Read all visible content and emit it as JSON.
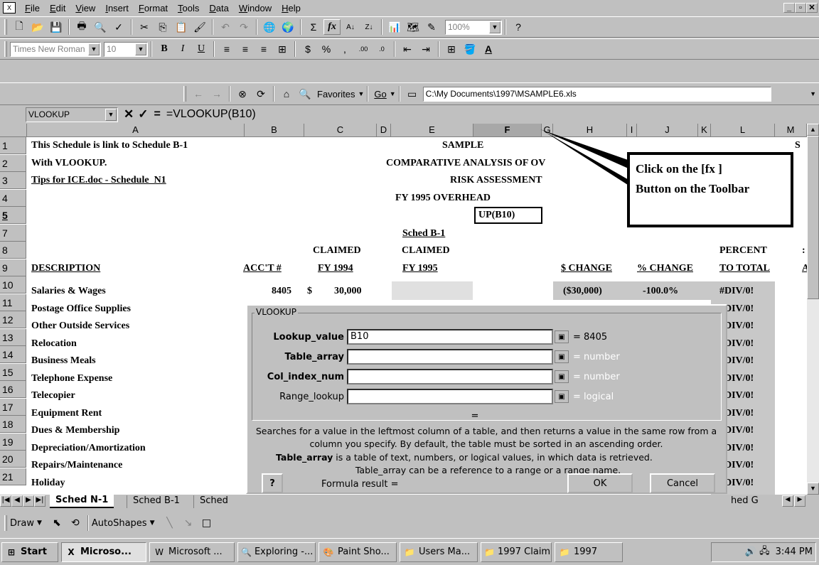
{
  "menu": {
    "items": [
      "File",
      "Edit",
      "View",
      "Insert",
      "Format",
      "Tools",
      "Data",
      "Window",
      "Help"
    ],
    "window_controls": [
      "_",
      "▫",
      "✕"
    ]
  },
  "toolbar": {
    "zoom": "100%",
    "font_name": "Times New Roman",
    "font_size": "10"
  },
  "web_toolbar": {
    "favorites": "Favorites",
    "go": "Go",
    "address": "C:\\My Documents\\1997\\MSAMPLE6.xls"
  },
  "formula_bar": {
    "name_box": "VLOOKUP",
    "cancel": "✕",
    "enter": "✓",
    "equals": "=",
    "formula": "=VLOOKUP(B10)"
  },
  "grid": {
    "columns": [
      "A",
      "B",
      "C",
      "D",
      "E",
      "F",
      "G",
      "H",
      "I",
      "J",
      "K",
      "L",
      "M"
    ],
    "row_numbers": [
      "1",
      "2",
      "3",
      "4",
      "5",
      "7",
      "8",
      "9",
      "10",
      "11",
      "12",
      "13",
      "14",
      "15",
      "16",
      "17",
      "18",
      "19",
      "20",
      "21"
    ],
    "row1_a": "This Schedule is link to Schedule B-1",
    "row1_title": "SAMPLE",
    "row1_right": "S",
    "row2_a": "With VLOOKUP.",
    "row2_title": "COMPARATIVE ANALYSIS OF OV",
    "row3_a": "Tips for ICE.doc - Schedule_N1",
    "row3_title": "RISK ASSESSMENT",
    "row4_title": "FY 1995 OVERHEAD",
    "row5_formula": "UP(B10)",
    "row7_e": "Sched B-1",
    "row8_c": "CLAIMED",
    "row8_e": "CLAIMED",
    "row8_l": "PERCENT",
    "row8_m": ":",
    "row9_a": "DESCRIPTION",
    "row9_b": "ACC'T #",
    "row9_c": "FY 1994",
    "row9_e": "FY 1995",
    "row9_h": "$ CHANGE",
    "row9_j": "% CHANGE",
    "row9_l": "TO TOTAL",
    "row9_m": "A",
    "row10_b": "8405",
    "row10_c_sym": "$",
    "row10_c": "30,000",
    "row10_h": "($30,000)",
    "row10_j": "-100.0%",
    "descriptions": [
      "Salaries & Wages",
      "Postage Office Supplies",
      "Other Outside Services",
      "Relocation",
      "Business Meals",
      "Telephone Expense",
      "Telecopier",
      "Equipment Rent",
      "Dues & Membership",
      "Depreciation/Amortization",
      "Repairs/Maintenance",
      "Holiday"
    ],
    "div_error": "#DIV/0!"
  },
  "callout": {
    "line1": "Click on the [fx ]",
    "line2": "Button on the Toolbar"
  },
  "dialog": {
    "title": "VLOOKUP",
    "fields": [
      {
        "label": "Lookup_value",
        "value": "B10",
        "result": "= 8405",
        "bold": true
      },
      {
        "label": "Table_array",
        "value": "",
        "result": "= number",
        "bold": true
      },
      {
        "label": "Col_index_num",
        "value": "",
        "result": "= number",
        "bold": true
      },
      {
        "label": "Range_lookup",
        "value": "",
        "result": "= logical",
        "bold": false
      }
    ],
    "total_result": "=",
    "description": "Searches for a value in the leftmost column of a table, and then returns a value in the same row from a column you specify. By default, the table must be sorted in an ascending order.",
    "arg_name": "Table_array",
    "arg_help": "is a table of text, numbers, or logical values, in which data is retrieved.",
    "arg_help2": "Table_array can be a reference to a range or a range name.",
    "formula_result": "Formula result =",
    "ok": "OK",
    "cancel": "Cancel",
    "help_icon": "?"
  },
  "sheet_tabs": {
    "tabs": [
      "Sched N-1",
      "Sched B-1",
      "Sched"
    ],
    "right_tab": "hed G"
  },
  "draw_toolbar": {
    "draw": "Draw",
    "autoshapes": "AutoShapes"
  },
  "taskbar": {
    "start": "Start",
    "tasks": [
      "Microso...",
      "Microsoft ...",
      "Exploring -...",
      "Paint Sho...",
      "Users Ma...",
      "1997 Claim",
      "1997"
    ],
    "clock": "3:44 PM"
  }
}
